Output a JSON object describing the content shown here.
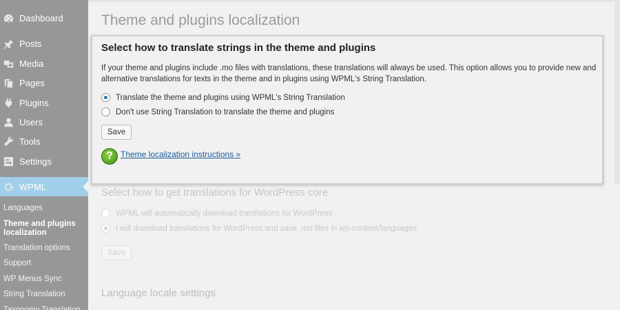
{
  "sidebar": {
    "menu": [
      {
        "label": "Dashboard",
        "icon": "dashboard-icon"
      },
      {
        "label": "Posts",
        "icon": "pin-icon"
      },
      {
        "label": "Media",
        "icon": "media-icon"
      },
      {
        "label": "Pages",
        "icon": "pages-icon"
      },
      {
        "label": "Plugins",
        "icon": "plugin-icon"
      },
      {
        "label": "Users",
        "icon": "user-icon"
      },
      {
        "label": "Tools",
        "icon": "wrench-icon"
      },
      {
        "label": "Settings",
        "icon": "settings-icon"
      },
      {
        "label": "WPML",
        "icon": "wpml-icon"
      }
    ],
    "submenu": [
      "Languages",
      "Theme and plugins localization",
      "Translation options",
      "Support",
      "WP Menus Sync",
      "String Translation",
      "Taxonomy Translation"
    ]
  },
  "main": {
    "page_title": "Theme and plugins localization",
    "panel": {
      "title": "Select how to translate strings in the theme and plugins",
      "description": "If your theme and plugins include .mo files with translations, these translations will always be used. This option allows you to provide new and alternative translations for texts in the theme and in plugins using WPML's String Translation.",
      "option1": "Translate the theme and plugins using WPML's String Translation",
      "option2": "Don't use String Translation to translate the theme and plugins",
      "save_label": "Save",
      "help_link": "Theme localization instructions »",
      "help_icon": "?"
    },
    "core": {
      "title": "Select how to get translations for WordPress core",
      "option1": "WPML will automatically download translations for WordPress",
      "option2": "I will download translations for WordPress and save .mo files in wp-content/languages",
      "save_label": "Save"
    },
    "locale_title": "Language locale settings"
  }
}
